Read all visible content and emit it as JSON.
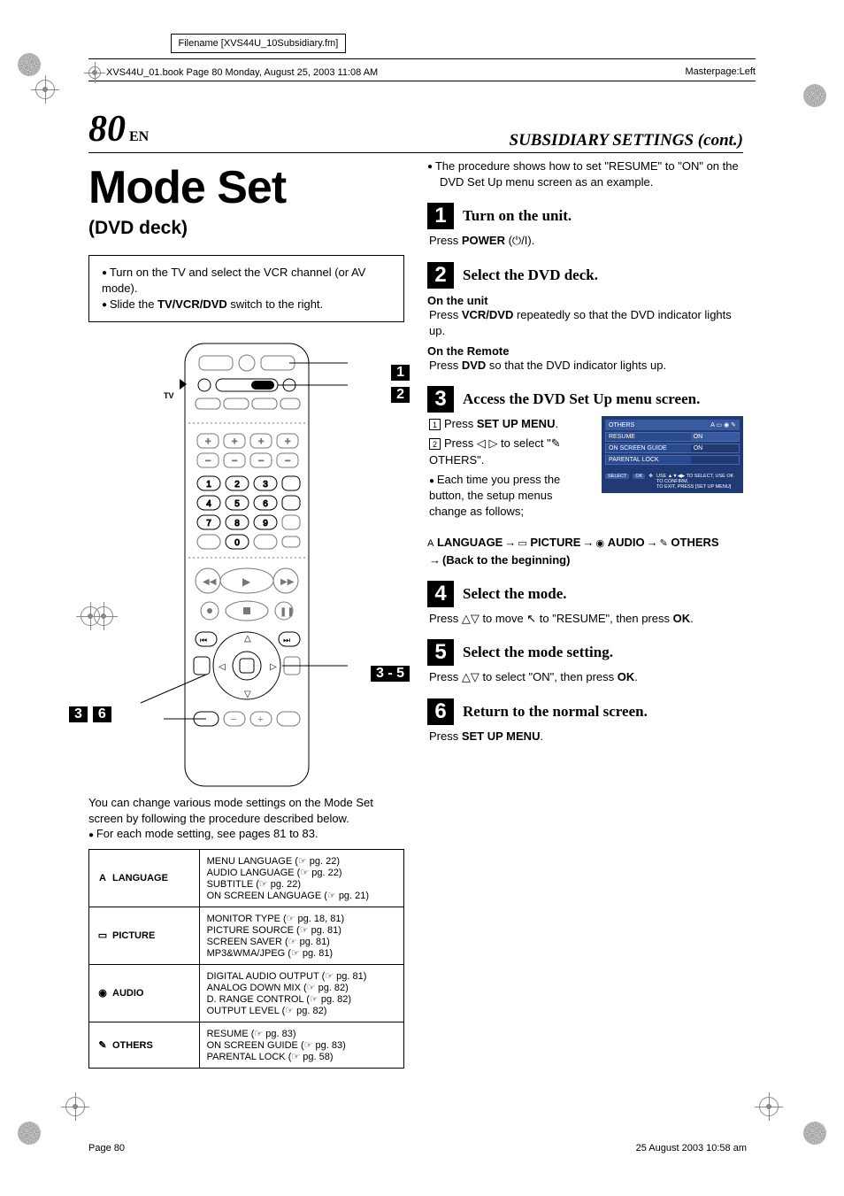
{
  "meta": {
    "filename_label": "Filename [XVS44U_10Subsidiary.fm]",
    "book_line": "XVS44U_01.book  Page 80  Monday, August 25, 2003  11:08 AM",
    "masterpage": "Masterpage:Left"
  },
  "page_number": "80",
  "page_number_suffix": "EN",
  "section_heading": "SUBSIDIARY SETTINGS (cont.)",
  "title": "Mode Set",
  "subtitle": "(DVD deck)",
  "prep_box": {
    "item1_a": "Turn on the TV and select the VCR channel (or AV mode).",
    "item2_a": "Slide the ",
    "item2_b": "TV/VCR/DVD",
    "item2_c": " switch to the right."
  },
  "remote": {
    "tv_label": "TV",
    "callouts": {
      "c1": "1",
      "c2": "2",
      "c3_5": "3 - 5",
      "c3_6_a": "3",
      "c3_6_b": "6"
    }
  },
  "caption": {
    "line1": "You can change various mode settings on the Mode Set screen by following the procedure described below.",
    "line2": "For each mode setting, see pages 81 to 83."
  },
  "settings_table": [
    {
      "icon": "A",
      "name": "LANGUAGE",
      "items": [
        "MENU LANGUAGE (☞ pg. 22)",
        "AUDIO LANGUAGE (☞ pg. 22)",
        "SUBTITLE (☞ pg. 22)",
        "ON SCREEN LANGUAGE (☞ pg. 21)"
      ]
    },
    {
      "icon": "▭",
      "name": "PICTURE",
      "items": [
        "MONITOR TYPE (☞ pg. 18, 81)",
        "PICTURE SOURCE (☞ pg. 81)",
        "SCREEN SAVER (☞ pg. 81)",
        "MP3&WMA/JPEG (☞ pg. 81)"
      ]
    },
    {
      "icon": "◉",
      "name": "AUDIO",
      "items": [
        "DIGITAL AUDIO OUTPUT (☞ pg. 81)",
        "ANALOG DOWN MIX (☞ pg. 82)",
        "D. RANGE CONTROL (☞ pg. 82)",
        "OUTPUT LEVEL (☞ pg. 82)"
      ]
    },
    {
      "icon": "✎",
      "name": "OTHERS",
      "items": [
        "RESUME (☞ pg. 83)",
        "ON SCREEN GUIDE (☞ pg. 83)",
        "PARENTAL LOCK (☞ pg. 58)"
      ]
    }
  ],
  "intro_para": {
    "bullet": "The procedure shows how to set \"RESUME\" to \"ON\" on the DVD Set Up menu screen as an example."
  },
  "steps": {
    "s1": {
      "title": "Turn on the unit.",
      "body_a": "Press ",
      "body_b": "POWER",
      "body_c": " (⏻/I)."
    },
    "s2": {
      "title": "Select the DVD deck.",
      "sub1_h": "On the unit",
      "sub1_a": "Press ",
      "sub1_b": "VCR/DVD",
      "sub1_c": " repeatedly so that the DVD indicator lights up.",
      "sub2_h": "On the Remote",
      "sub2_a": "Press ",
      "sub2_b": "DVD",
      "sub2_c": " so that the DVD indicator lights up."
    },
    "s3": {
      "title": "Access the DVD Set Up menu screen.",
      "l1_a": "Press ",
      "l1_b": "SET UP MENU",
      "l1_c": ".",
      "l2": "Press ◁ ▷ to select \"✎ OTHERS\".",
      "l3": "Each time you press the button, the setup menus change as follows;"
    },
    "s4": {
      "title": "Select the mode.",
      "body_a": "Press △▽ to move ↖ to \"RESUME\", then press ",
      "body_b": "OK",
      "body_c": "."
    },
    "s5": {
      "title": "Select the mode setting.",
      "body_a": "Press △▽ to select \"ON\", then press ",
      "body_b": "OK",
      "body_c": "."
    },
    "s6": {
      "title": "Return to the normal screen.",
      "body_a": "Press ",
      "body_b": "SET UP MENU",
      "body_c": "."
    }
  },
  "menu_flow": {
    "i1": "A",
    "t1": "LANGUAGE",
    "i2": "▭",
    "t2": "PICTURE",
    "i3": "◉",
    "t3": "AUDIO",
    "i4": "✎",
    "t4": "OTHERS",
    "back": "(Back to the beginning)"
  },
  "osd": {
    "header": "OTHERS",
    "rows": [
      {
        "label": "RESUME",
        "value": "ON"
      },
      {
        "label": "ON SCREEN GUIDE",
        "value": "ON"
      },
      {
        "label": "PARENTAL LOCK",
        "value": ""
      }
    ],
    "hint_k1": "SELECT",
    "hint_k2": "OK",
    "hint_text1": "USE ▲▼◀▶ TO SELECT, USE OK TO CONFIRM,",
    "hint_text2": "TO EXIT, PRESS [SET UP MENU]"
  },
  "footer": {
    "left": "Page 80",
    "right": "25 August 2003 10:58 am"
  }
}
